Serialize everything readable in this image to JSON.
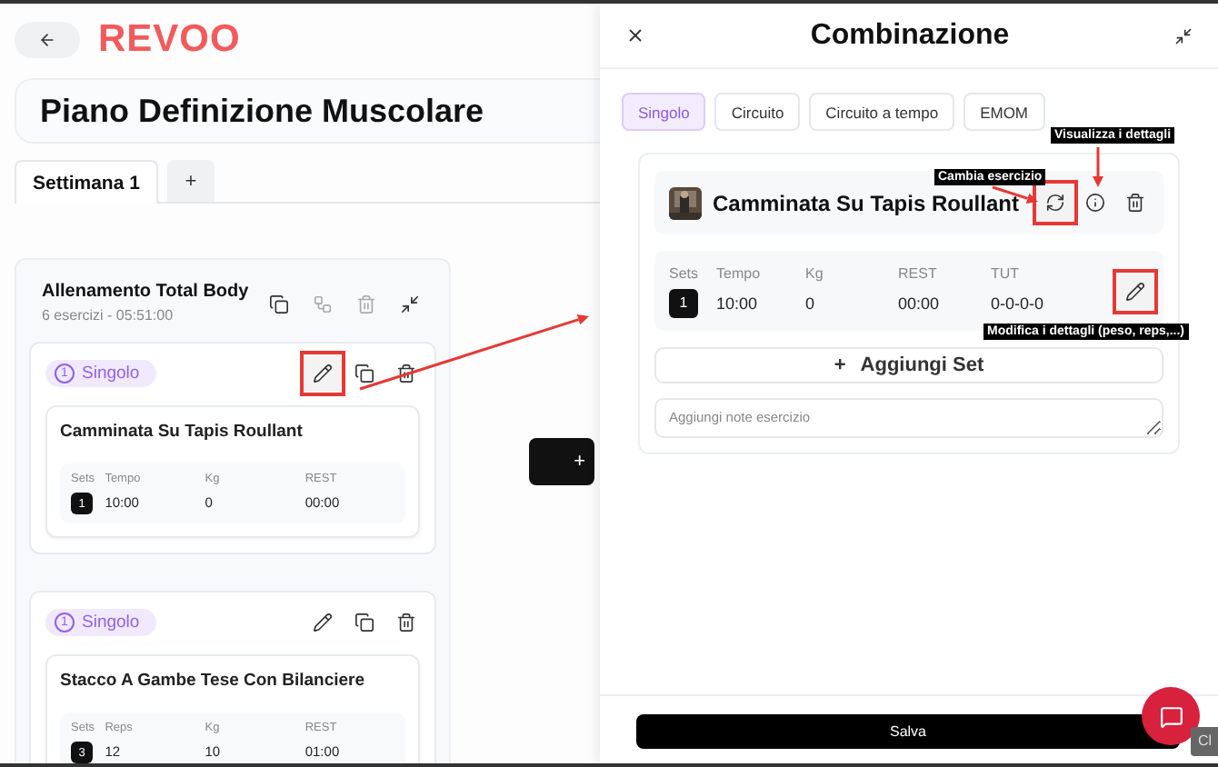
{
  "header": {
    "logo": "REVOO"
  },
  "plan_title": "Piano Definizione Muscolare",
  "week_tabs": [
    {
      "label": "Settimana 1",
      "selected": true
    }
  ],
  "add_week": "+",
  "workout": {
    "title": "Allenamento Total Body",
    "subtitle": "6 esercizi - 05:51:00",
    "blocks": [
      {
        "number": "1",
        "type": "Singolo",
        "highlighted": true,
        "exercise": "Camminata Su Tapis Roullant",
        "stats": [
          {
            "label": "Sets",
            "value": "1",
            "kind": "badge"
          },
          {
            "label": "Tempo",
            "value": "10:00",
            "kind": "plain"
          },
          {
            "label": "Kg",
            "value": "0",
            "kind": "plain"
          },
          {
            "label": "REST",
            "value": "00:00",
            "kind": "plain"
          }
        ]
      },
      {
        "number": "1",
        "type": "Singolo",
        "highlighted": false,
        "exercise": "Stacco A Gambe Tese Con Bilanciere",
        "stats": [
          {
            "label": "Sets",
            "value": "3",
            "kind": "badge"
          },
          {
            "label": "Reps",
            "value": "12",
            "kind": "plain"
          },
          {
            "label": "Kg",
            "value": "10",
            "kind": "plain"
          },
          {
            "label": "REST",
            "value": "01:00",
            "kind": "plain"
          }
        ]
      }
    ]
  },
  "add_block": "+",
  "drawer": {
    "title": "Combinazione",
    "modes": [
      {
        "label": "Singolo",
        "selected": true
      },
      {
        "label": "Circuito",
        "selected": false
      },
      {
        "label": "Circuito a tempo",
        "selected": false
      },
      {
        "label": "EMOM",
        "selected": false
      }
    ],
    "exercise": {
      "name": "Camminata Su Tapis Roullant",
      "swap_highlighted": true,
      "edit_highlighted": true,
      "stats": [
        {
          "label": "Sets",
          "value": "1",
          "kind": "badge"
        },
        {
          "label": "Tempo",
          "value": "10:00",
          "kind": "plain"
        },
        {
          "label": "Kg",
          "value": "0",
          "kind": "plain"
        },
        {
          "label": "REST",
          "value": "00:00",
          "kind": "plain"
        },
        {
          "label": "TUT",
          "value": "0-0-0-0",
          "kind": "plain"
        }
      ]
    },
    "add_set": "Aggiungi Set",
    "add_set_icon": "+",
    "notes_placeholder": "Aggiungi note esercizio",
    "save": "Salva"
  },
  "annotations": {
    "swap": "Cambia esercizio",
    "details": "Visualizza i dettagli",
    "edit": "Modifica i dettagli (peso, reps,...)"
  },
  "side_tab": "Cl"
}
